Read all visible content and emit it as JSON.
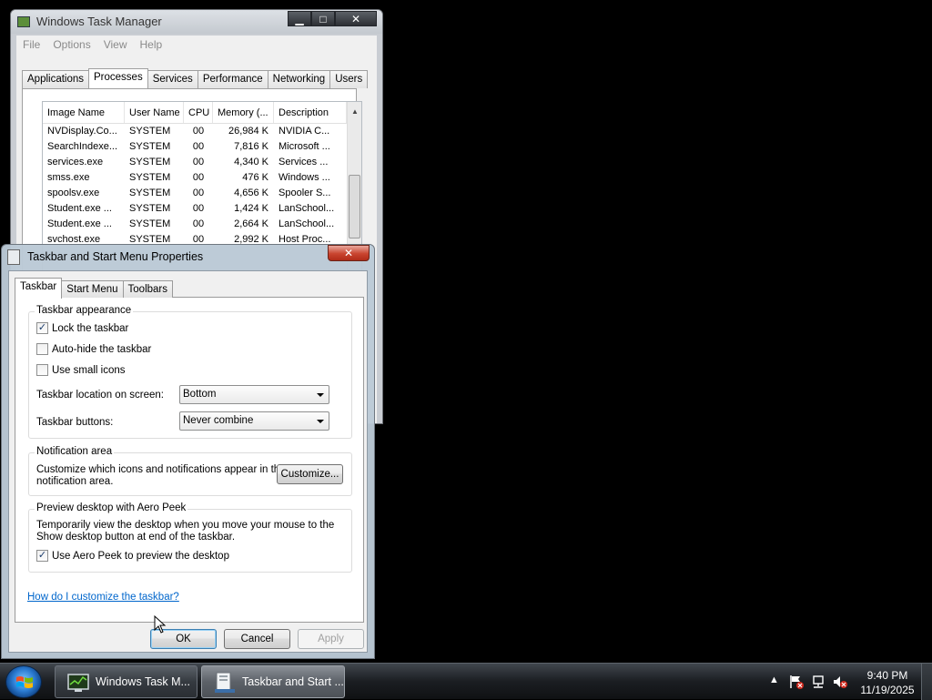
{
  "task_manager": {
    "title": "Windows Task Manager",
    "menu": [
      "File",
      "Options",
      "View",
      "Help"
    ],
    "tabs": [
      "Applications",
      "Processes",
      "Services",
      "Performance",
      "Networking",
      "Users"
    ],
    "active_tab": "Processes",
    "columns": [
      "Image Name",
      "User Name",
      "CPU",
      "Memory (...",
      "Description"
    ],
    "rows": [
      {
        "image": "NVDisplay.Co...",
        "user": "SYSTEM",
        "cpu": "00",
        "memory": "26,984 K",
        "desc": "NVIDIA C..."
      },
      {
        "image": "SearchIndexe...",
        "user": "SYSTEM",
        "cpu": "00",
        "memory": "7,816 K",
        "desc": "Microsoft ..."
      },
      {
        "image": "services.exe",
        "user": "SYSTEM",
        "cpu": "00",
        "memory": "4,340 K",
        "desc": "Services ..."
      },
      {
        "image": "smss.exe",
        "user": "SYSTEM",
        "cpu": "00",
        "memory": "476 K",
        "desc": "Windows ..."
      },
      {
        "image": "spoolsv.exe",
        "user": "SYSTEM",
        "cpu": "00",
        "memory": "4,656 K",
        "desc": "Spooler S..."
      },
      {
        "image": "Student.exe ...",
        "user": "SYSTEM",
        "cpu": "00",
        "memory": "1,424 K",
        "desc": "LanSchool..."
      },
      {
        "image": "Student.exe ...",
        "user": "SYSTEM",
        "cpu": "00",
        "memory": "2,664 K",
        "desc": "LanSchool..."
      },
      {
        "image": "svchost.exe",
        "user": "SYSTEM",
        "cpu": "00",
        "memory": "2,992 K",
        "desc": "Host Proc..."
      }
    ],
    "caption_buttons": {
      "minimize": "▁",
      "maximize": "□",
      "close": "✕"
    }
  },
  "dialog": {
    "title": "Taskbar and Start Menu Properties",
    "close": "✕",
    "tabs": [
      "Taskbar",
      "Start Menu",
      "Toolbars"
    ],
    "active_tab": "Taskbar",
    "appearance": {
      "group_title": "Taskbar appearance",
      "lock_label": "Lock the taskbar",
      "lock_checked": true,
      "autohide_label": "Auto-hide the taskbar",
      "autohide_checked": false,
      "small_icons_label": "Use small icons",
      "small_icons_checked": false,
      "location_label": "Taskbar location on screen:",
      "location_value": "Bottom",
      "buttons_label": "Taskbar buttons:",
      "buttons_value": "Never combine"
    },
    "notification": {
      "group_title": "Notification area",
      "text_line1": "Customize which icons and notifications appear in the",
      "text_line2": "notification area.",
      "customize_button": "Customize..."
    },
    "aero_peek": {
      "group_title": "Preview desktop with Aero Peek",
      "text_line1": "Temporarily view the desktop when you move your mouse to the",
      "text_line2": "Show desktop button at end of the taskbar.",
      "use_label": "Use Aero Peek to preview the desktop",
      "use_checked": true
    },
    "help_link": "How do I customize the taskbar?",
    "ok": "OK",
    "cancel": "Cancel",
    "apply": "Apply",
    "apply_enabled": false
  },
  "taskbar": {
    "buttons": [
      {
        "label": "Windows Task M...",
        "icon": "task-manager-icon",
        "active": false
      },
      {
        "label": "Taskbar and Start ...",
        "icon": "properties-icon",
        "active": true
      }
    ],
    "tray": {
      "show_hidden_arrow": "▲",
      "time": "9:40 PM",
      "date": "11/19/2025"
    }
  },
  "colors": {
    "desktop": "#000000",
    "link": "#0066cc",
    "dialog_frame": "#bbc9d6",
    "close_button": "#c9442f"
  }
}
